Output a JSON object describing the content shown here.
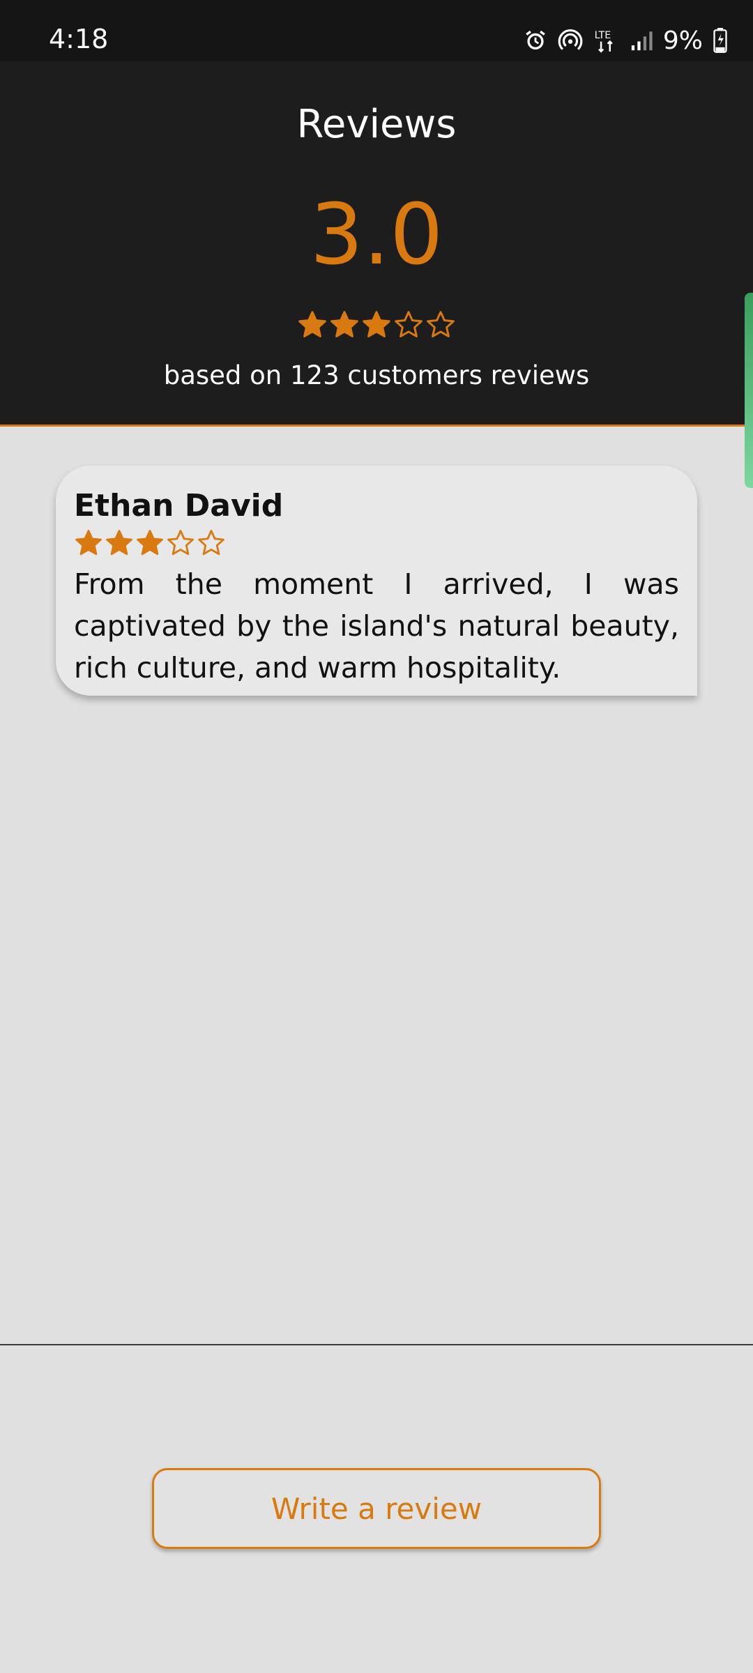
{
  "status_bar": {
    "time": "4:18",
    "network": "LTE",
    "battery": "9%",
    "icons": [
      "alarm-icon",
      "hotspot-icon",
      "lte-icon",
      "signal-icon",
      "battery-charging-icon"
    ]
  },
  "header": {
    "title": "Reviews",
    "average_rating": "3.0",
    "stars_filled": 3,
    "stars_total": 5,
    "based_on": "based on 123 customers reviews"
  },
  "reviews": [
    {
      "name": "Ethan David",
      "stars_filled": 3,
      "stars_total": 5,
      "text": "From the moment I arrived, I was captivated by the island's natural beauty, rich culture, and warm hospitality."
    }
  ],
  "actions": {
    "write_review_label": "Write a review"
  },
  "colors": {
    "accent": "#d97a10",
    "header_bg": "#1d1d1d",
    "page_bg": "#e0e0e0"
  }
}
